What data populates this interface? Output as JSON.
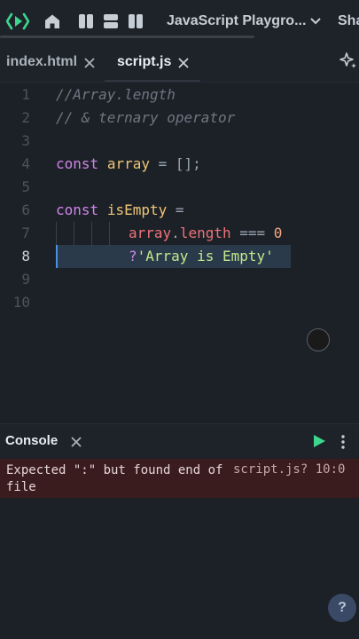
{
  "topbar": {
    "project_title": "JavaScript Playgro...",
    "share_label": "Sha",
    "icons": [
      "replit-logo-icon",
      "home-icon",
      "layout-left-icon",
      "layout-split-icon",
      "layout-right-icon",
      "chevron-down-icon"
    ],
    "accent": "#3dd68c"
  },
  "tabs": [
    {
      "label": "index.html",
      "active": false
    },
    {
      "label": "script.js",
      "active": true
    }
  ],
  "editor": {
    "line_numbers": [
      "1",
      "2",
      "3",
      "4",
      "5",
      "6",
      "7",
      "8",
      "9",
      "10"
    ],
    "lines": {
      "l1": "//Array.length",
      "l2": "// & ternary operator",
      "l4_kw": "const",
      "l4_var": "array",
      "l4_rest": " = [];",
      "l6_kw": "const",
      "l6_var": "isEmpty",
      "l6_rest": " =",
      "l7_obj": "array",
      "l7_dot": ".",
      "l7_prop": "length",
      "l7_op": " === ",
      "l7_num": "0",
      "l8_q": "?",
      "l8_str": "'Array is Empty'"
    }
  },
  "console": {
    "title": "Console",
    "error_message": "Expected \":\" but found end of file",
    "error_location": "script.js? 10:0",
    "help_label": "?"
  }
}
